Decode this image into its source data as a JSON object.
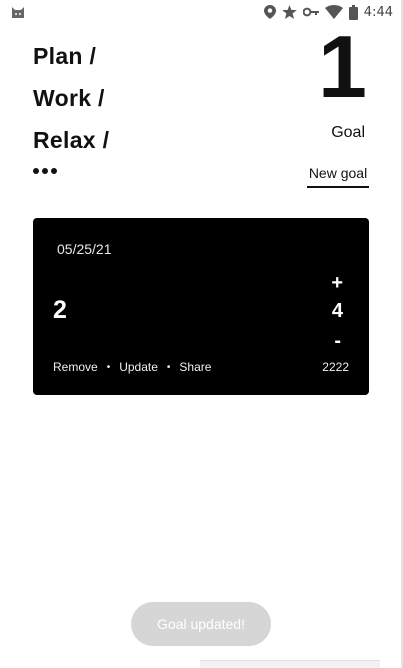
{
  "status_bar": {
    "time": "4:44",
    "icons": [
      "app-cat-icon",
      "location-icon",
      "star-icon",
      "key-icon",
      "wifi-icon",
      "battery-icon"
    ]
  },
  "header": {
    "title_lines": [
      "Plan /",
      "Work /",
      "Relax /"
    ],
    "goal_count": "1",
    "goal_label": "Goal",
    "new_goal_label": "New goal"
  },
  "card": {
    "date": "05/25/21",
    "value": "2",
    "plus": "+",
    "count": "4",
    "minus": "-",
    "actions": [
      "Remove",
      "Update",
      "Share"
    ],
    "separator": "•",
    "code": "2222"
  },
  "toast": {
    "message": "Goal updated!"
  },
  "colors": {
    "background": "#ffffff",
    "text": "#111111",
    "card": "#000000",
    "toast": "#d6d6d6"
  }
}
